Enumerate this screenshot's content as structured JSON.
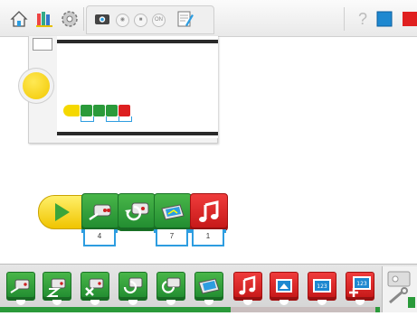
{
  "app": {
    "toolbar": {
      "icons": [
        "home-icon",
        "books-icon",
        "gear-icon",
        "camera-icon",
        "photo-icon",
        "video-icon",
        "on-icon",
        "note-icon",
        "help-icon",
        "screen-icon",
        "exit-icon"
      ],
      "tab_labels": {
        "small_on": "ON"
      }
    },
    "colors": {
      "green_block": "#2a9a3a",
      "red_block": "#dd2020",
      "start_yellow": "#f5d800",
      "param_blue": "#2d9de0"
    },
    "program": {
      "blocks": [
        {
          "name": "start-block",
          "icon": "play-icon"
        },
        {
          "name": "motor-forward-block",
          "icon": "motor-icon",
          "param": "4"
        },
        {
          "name": "motor-turn-block",
          "icon": "turn-arrow-icon",
          "param": ""
        },
        {
          "name": "display-block",
          "icon": "display-icon",
          "param": "7"
        },
        {
          "name": "sound-block",
          "icon": "music-note-icon",
          "param": "1"
        }
      ]
    },
    "palette": {
      "items": [
        "motor-forward-icon",
        "motor-stop-icon",
        "motor-off-icon",
        "motor-turn-left-icon",
        "motor-turn-right-icon",
        "motor-display-icon",
        "sound-icon",
        "background-icon",
        "display-number-icon",
        "add-number-icon",
        "tools-icon"
      ]
    }
  }
}
